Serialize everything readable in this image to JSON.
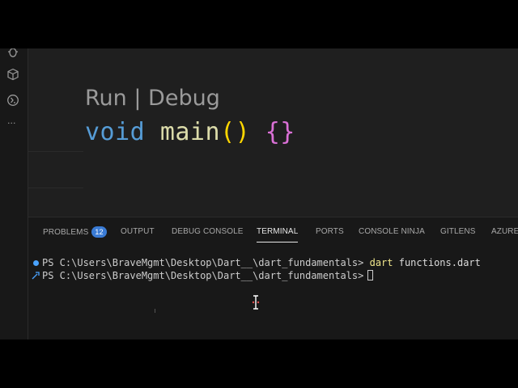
{
  "editor": {
    "codelens": {
      "run": "Run",
      "separator": " | ",
      "debug": "Debug"
    },
    "code": {
      "keyword": "void",
      "function_name": "main",
      "parens": "()",
      "braces": "{}"
    }
  },
  "activity_bar": {
    "icons": [
      "debug-icon",
      "extensions-icon",
      "remote-icon"
    ],
    "more": "···"
  },
  "panel": {
    "tabs": [
      {
        "label": "PROBLEMS",
        "badge": "12"
      },
      {
        "label": "OUTPUT"
      },
      {
        "label": "DEBUG CONSOLE"
      },
      {
        "label": "TERMINAL",
        "active": true
      },
      {
        "label": "PORTS"
      },
      {
        "label": "CONSOLE NINJA"
      },
      {
        "label": "GITLENS"
      },
      {
        "label": "AZURE"
      }
    ]
  },
  "terminal": {
    "line1": {
      "prompt": "PS C:\\Users\\BraveMgmt\\Desktop\\Dart__\\dart_fundamentals>",
      "command": "dart",
      "argument": "functions.dart"
    },
    "line2": {
      "prompt": "PS C:\\Users\\BraveMgmt\\Desktop\\Dart__\\dart_fundamentals>"
    }
  },
  "colors": {
    "keyword": "#569cd6",
    "function": "#dcdcaa",
    "paren": "#ffd700",
    "brace": "#da70d6",
    "badge": "#3a7bd5",
    "command": "#f0e68c"
  }
}
